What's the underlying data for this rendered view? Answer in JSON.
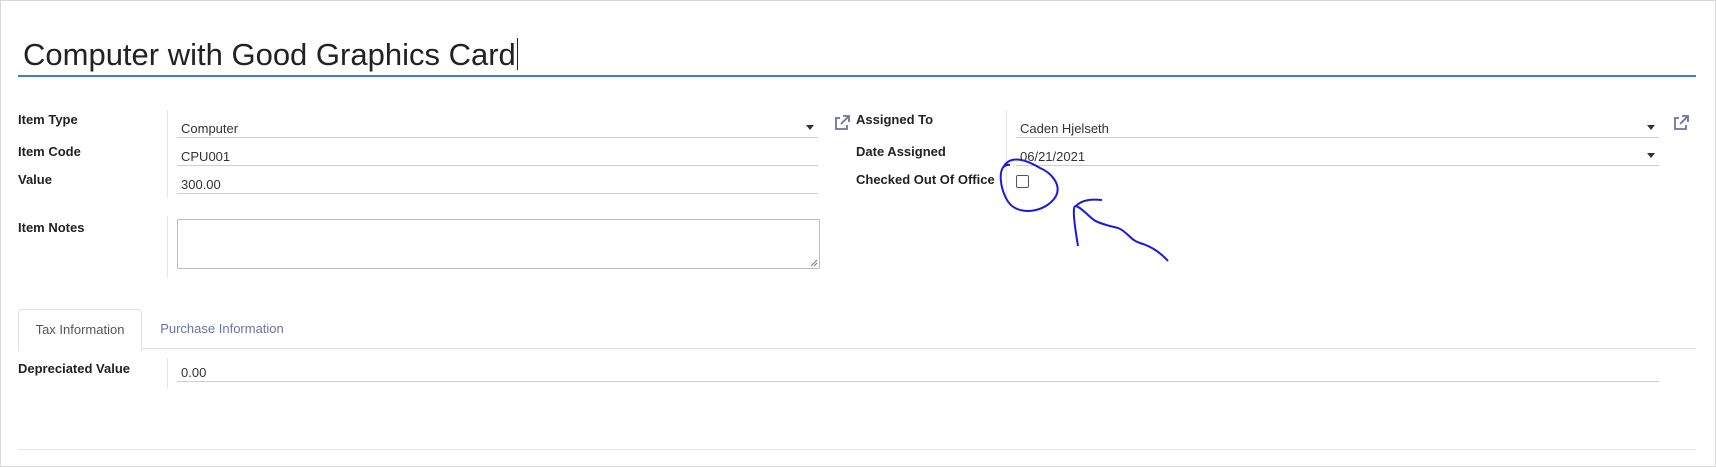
{
  "record": {
    "title": "Computer with Good Graphics Card"
  },
  "left_group": {
    "item_type": {
      "label": "Item Type",
      "value": "Computer"
    },
    "item_code": {
      "label": "Item Code",
      "value": "CPU001"
    },
    "value": {
      "label": "Value",
      "value": "300.00"
    },
    "item_notes": {
      "label": "Item Notes",
      "value": ""
    }
  },
  "right_group": {
    "assigned_to": {
      "label": "Assigned To",
      "value": "Caden Hjelseth"
    },
    "date_assigned": {
      "label": "Date Assigned",
      "value": "06/21/2021"
    },
    "checked_out_of_office": {
      "label": "Checked Out Of Office",
      "checked": false
    }
  },
  "tabs": [
    {
      "label": "Tax Information",
      "active": true
    },
    {
      "label": "Purchase Information",
      "active": false
    }
  ],
  "tax_information": {
    "depreciated_value": {
      "label": "Depreciated Value",
      "value": "0.00"
    }
  },
  "colors": {
    "title_underline": "#3a7bd5",
    "link_icon": "#6c72a3",
    "annotation": "#1a1adb"
  },
  "icons": {
    "item_type_link": "external-link-icon",
    "assigned_to_link": "external-link-icon",
    "dropdown": "caret-down-icon"
  }
}
